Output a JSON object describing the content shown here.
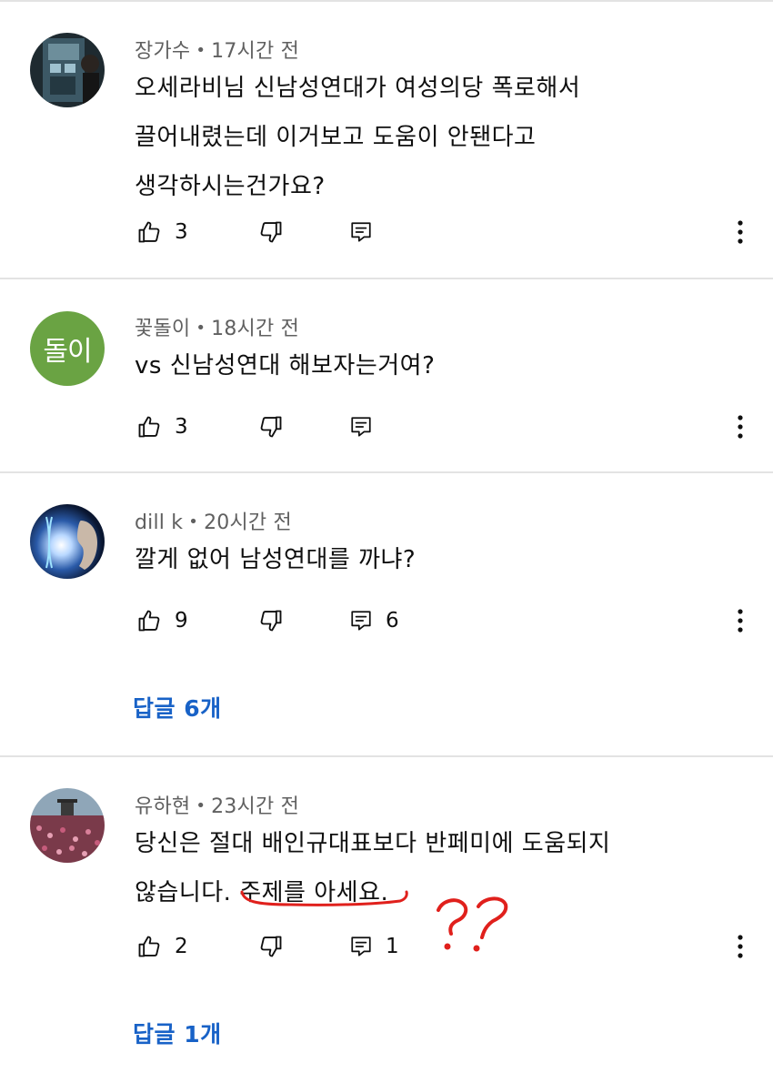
{
  "comments": [
    {
      "author": "장가수",
      "time": "17시간 전",
      "lines": [
        "오세라비님 신남성연대가 여성의당 폭로해서",
        "끌어내렸는데 이거보고 도움이 안됀다고",
        "생각하시는건가요?"
      ],
      "likes": "3",
      "reply_count": "",
      "avatar_icon": "photo-avatar"
    },
    {
      "author": "꽃돌이",
      "time": "18시간 전",
      "lines": [
        "vs 신남성연대 해보자는거여?"
      ],
      "likes": "3",
      "reply_count": "",
      "avatar_letter": "돌이",
      "avatar_color": "#6aa343"
    },
    {
      "author": "dill k",
      "time": "20시간 전",
      "lines": [
        "깔게 없어 남성연대를 까냐?"
      ],
      "likes": "9",
      "reply_count": "6",
      "replies_link": "답글 6개",
      "avatar_icon": "photo-avatar"
    },
    {
      "author": "유하현",
      "time": "23시간 전",
      "lines": [
        "당신은 절대 배인규대표보다 반페미에 도움되지",
        "않습니다. 주제를 아세요."
      ],
      "likes": "2",
      "reply_count": "1",
      "replies_link": "답글 1개",
      "avatar_icon": "photo-avatar"
    }
  ],
  "separator_dot": "•",
  "annotation_mark": "??",
  "colors": {
    "link": "#1862c7",
    "meta": "#606060",
    "annotation": "#e0201c",
    "divider": "#e3e3e3"
  },
  "icons": [
    "thumbs-up-icon",
    "thumbs-down-icon",
    "reply-icon",
    "more-vertical-icon"
  ]
}
